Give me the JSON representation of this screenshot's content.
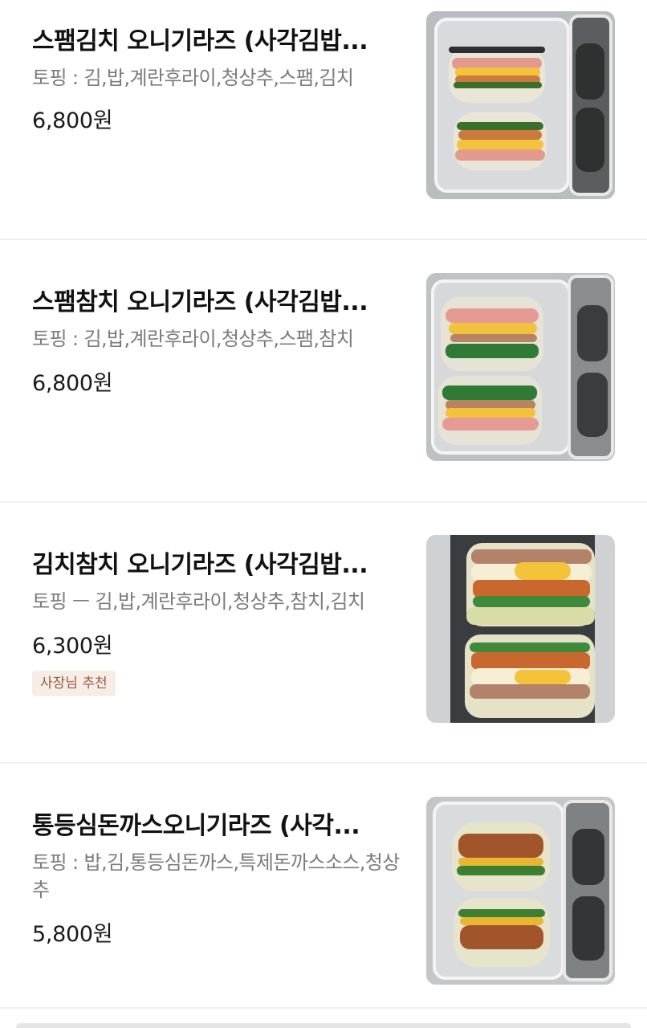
{
  "menu": {
    "items": [
      {
        "name": "스팸김치 오니기라즈  (사각김밥...",
        "toppings": "토핑 : 김,밥,계란후라이,청상추,스팸,김치",
        "price": "6,800원",
        "badge": ""
      },
      {
        "name": "스팸참치 오니기라즈  (사각김밥...",
        "toppings": "토핑 : 김,밥,계란후라이,청상추,스팸,참치",
        "price": "6,800원",
        "badge": ""
      },
      {
        "name": "김치참치 오니기라즈 (사각김밥...",
        "toppings": "토핑 ㅡ 김,밥,계란후라이,청상추,참치,김치",
        "price": "6,300원",
        "badge": "사장님 추천"
      },
      {
        "name": "통등심돈까스오니기라즈  (사각...",
        "toppings": "토핑 : 밥,김,통등심돈까스,특제돈까스소스,청상추",
        "price": "5,800원",
        "badge": ""
      }
    ]
  },
  "colors": {
    "title": "#111111",
    "description": "#7b7b7b",
    "badge_bg": "#f6ede6",
    "badge_text": "#9a5b3e",
    "divider": "#efefef"
  }
}
